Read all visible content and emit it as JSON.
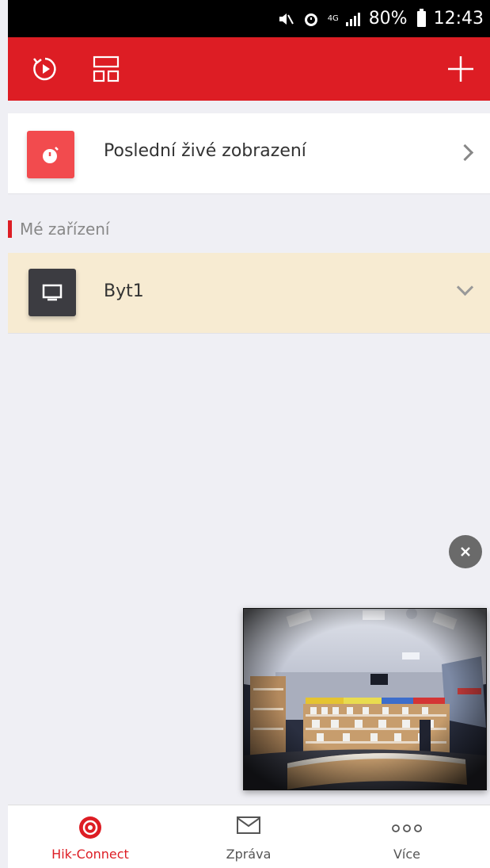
{
  "status_bar": {
    "network": "4G",
    "battery": "80%",
    "time": "12:43"
  },
  "recent": {
    "label": "Poslední živé zobrazení"
  },
  "devices": {
    "section_title": "Mé zařízení",
    "items": [
      {
        "name": "Byt1"
      }
    ]
  },
  "tabs": [
    {
      "label": "Hik-Connect",
      "icon": "live-view-icon",
      "active": true
    },
    {
      "label": "Zpráva",
      "icon": "mail-icon",
      "active": false
    },
    {
      "label": "Více",
      "icon": "more-icon",
      "active": false
    }
  ],
  "colors": {
    "brand_red": "#dd1d24",
    "selected_row": "#f7ebd2"
  }
}
